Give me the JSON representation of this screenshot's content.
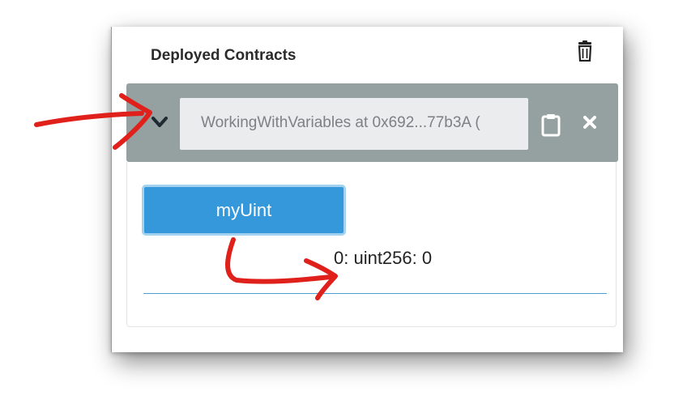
{
  "panel": {
    "title": "Deployed Contracts"
  },
  "contract": {
    "instance_label": "WorkingWithVariables at 0x692...77b3A (",
    "expand_icon": "chevron-down-icon",
    "copy_icon": "clipboard-icon",
    "remove_icon": "close-icon"
  },
  "function": {
    "button_label": "myUint",
    "result": "0: uint256: 0"
  },
  "icons": {
    "delete_all": "trash-icon"
  },
  "colors": {
    "header_bar": "#95a0a0",
    "button": "#3598db",
    "annotation": "#e0201b"
  }
}
